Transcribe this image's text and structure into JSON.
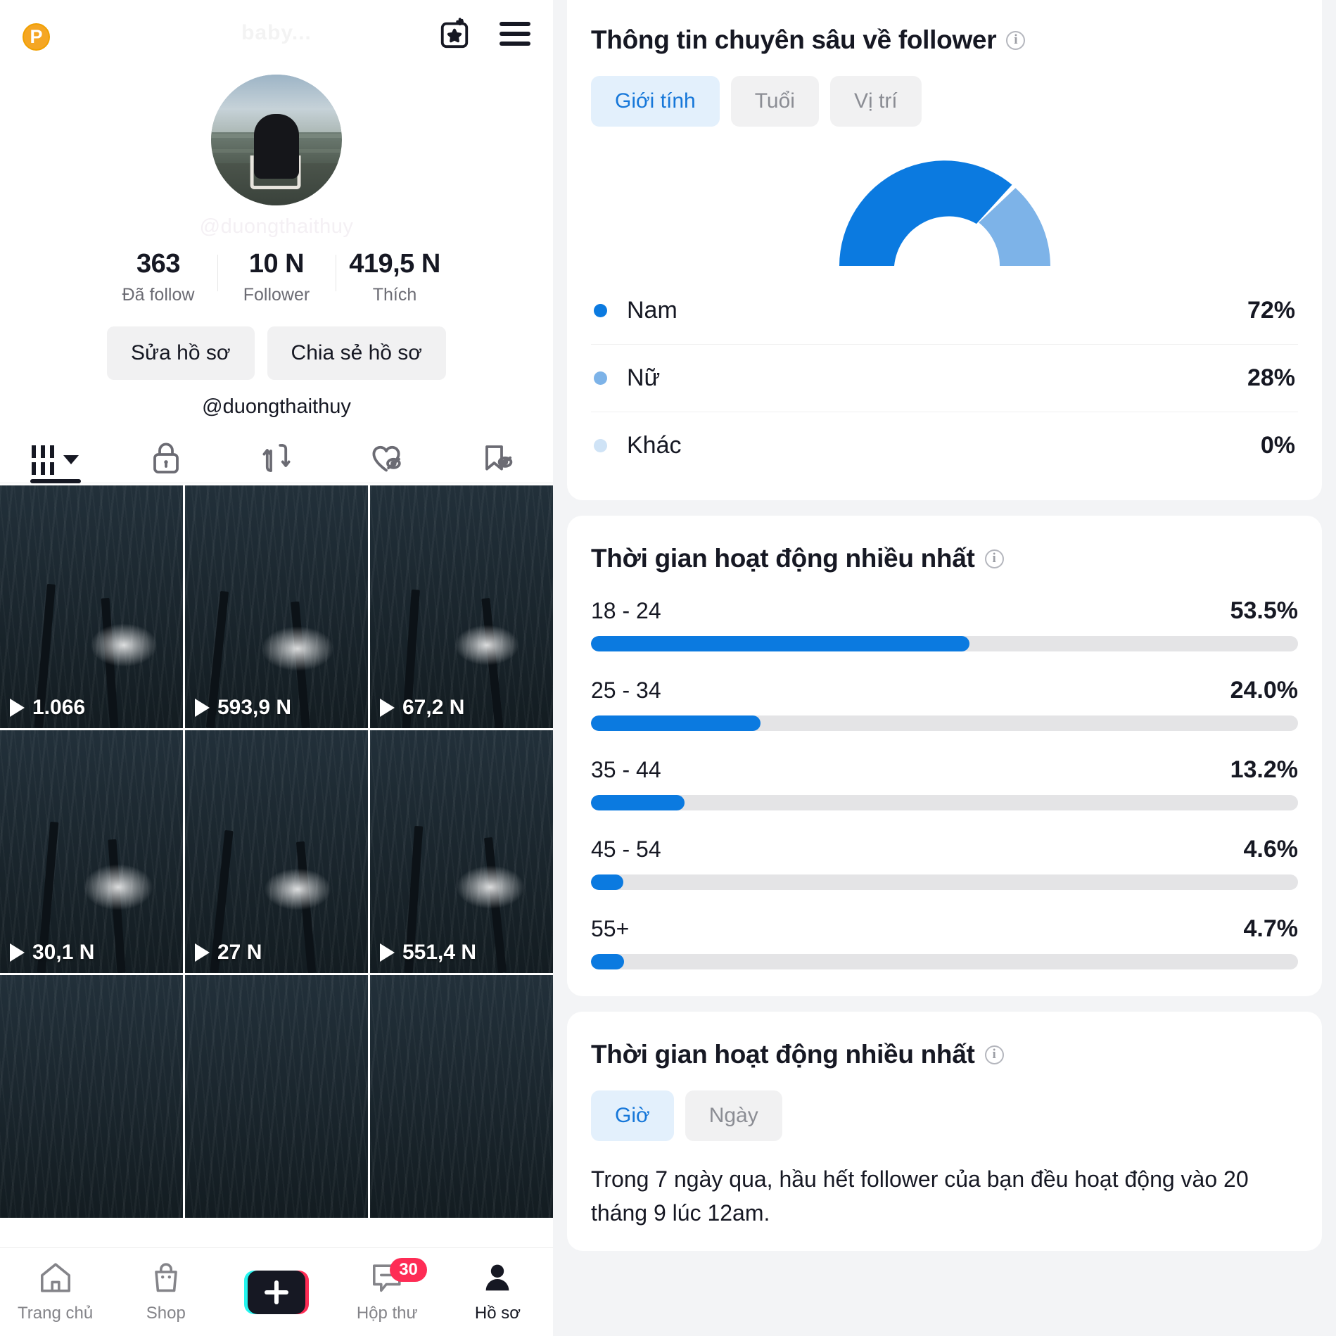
{
  "left": {
    "topbar": {
      "coin_label": "P",
      "ghost_title": "baby...",
      "calendar_star_icon": "calendar-star-icon",
      "menu_icon": "hamburger-menu-icon"
    },
    "profile": {
      "handle_ghost": "@duongthaithuy",
      "handle": "@duongthaithuy",
      "stats": [
        {
          "value": "363",
          "label": "Đã follow"
        },
        {
          "value": "10 N",
          "label": "Follower"
        },
        {
          "value": "419,5 N",
          "label": "Thích"
        }
      ],
      "edit_button": "Sửa hồ sơ",
      "share_button": "Chia sẻ hồ sơ"
    },
    "tabs": [
      {
        "icon": "grid-videos-icon",
        "active": true
      },
      {
        "icon": "lock-private-icon",
        "active": false
      },
      {
        "icon": "repost-arrows-icon",
        "active": false
      },
      {
        "icon": "heart-hidden-icon",
        "active": false
      },
      {
        "icon": "bookmark-hidden-icon",
        "active": false
      }
    ],
    "videos": [
      {
        "views": "1.066"
      },
      {
        "views": "593,9 N"
      },
      {
        "views": "67,2 N"
      },
      {
        "views": "30,1 N"
      },
      {
        "views": "27 N"
      },
      {
        "views": "551,4 N"
      },
      {
        "views": ""
      },
      {
        "views": ""
      },
      {
        "views": ""
      }
    ],
    "bottomnav": [
      {
        "label": "Trang chủ",
        "icon": "home-icon",
        "active": false,
        "badge": ""
      },
      {
        "label": "Shop",
        "icon": "shop-bag-icon",
        "active": false,
        "badge": ""
      },
      {
        "label": "",
        "icon": "create-plus-icon",
        "active": false,
        "badge": ""
      },
      {
        "label": "Hộp thư",
        "icon": "inbox-message-icon",
        "active": false,
        "badge": "30"
      },
      {
        "label": "Hồ sơ",
        "icon": "profile-person-icon",
        "active": true,
        "badge": ""
      }
    ]
  },
  "right": {
    "follower_insights": {
      "title": "Thông tin chuyên sâu về follower",
      "info_icon": "info-icon",
      "segments": [
        {
          "label": "Giới tính",
          "active": true
        },
        {
          "label": "Tuổi",
          "active": false
        },
        {
          "label": "Vị trí",
          "active": false
        }
      ]
    },
    "age_section": {
      "title": "Thời gian hoạt động nhiều nhất",
      "info_icon": "info-icon"
    },
    "activity_section": {
      "title": "Thời gian hoạt động nhiều nhất",
      "info_icon": "info-icon",
      "segments": [
        {
          "label": "Giờ",
          "active": true
        },
        {
          "label": "Ngày",
          "active": false
        }
      ],
      "note": "Trong 7 ngày qua, hầu hết follower của bạn đều hoạt động vào 20 tháng 9 lúc 12am."
    }
  },
  "colors": {
    "primary_blue": "#0b7ae0",
    "light_blue": "#7db3e8",
    "pale_blue": "#cfe3f6",
    "accent_pink": "#fe2c55",
    "accent_cyan": "#25f4ee",
    "track_gray": "#e4e4e6",
    "panel_bg": "#f3f4f6"
  },
  "chart_data": [
    {
      "type": "pie",
      "title": "Giới tính",
      "subtitle": "Thông tin chuyên sâu về follower",
      "legend_position": "bottom",
      "labels": [
        "Nam",
        "Nữ",
        "Khác"
      ],
      "values": [
        72,
        28,
        0
      ],
      "value_labels": [
        "72%",
        "28%",
        "0%"
      ],
      "colors": [
        "#0b7ae0",
        "#7db3e8",
        "#cfe3f6"
      ],
      "note": "semi-circular donut gauge, 180 degree sweep"
    },
    {
      "type": "bar",
      "title": "Thời gian hoạt động nhiều nhất",
      "orientation": "horizontal",
      "categories": [
        "18 - 24",
        "25 - 34",
        "35 - 44",
        "45 - 54",
        "55+"
      ],
      "values": [
        53.5,
        24.0,
        13.2,
        4.6,
        4.7
      ],
      "value_labels": [
        "53.5%",
        "24.0%",
        "13.2%",
        "4.6%",
        "4.7%"
      ],
      "xlabel": "",
      "ylabel": "",
      "xlim": [
        0,
        100
      ],
      "grid": false,
      "bar_color": "#0b7ae0",
      "track_color": "#e4e4e6"
    }
  ]
}
